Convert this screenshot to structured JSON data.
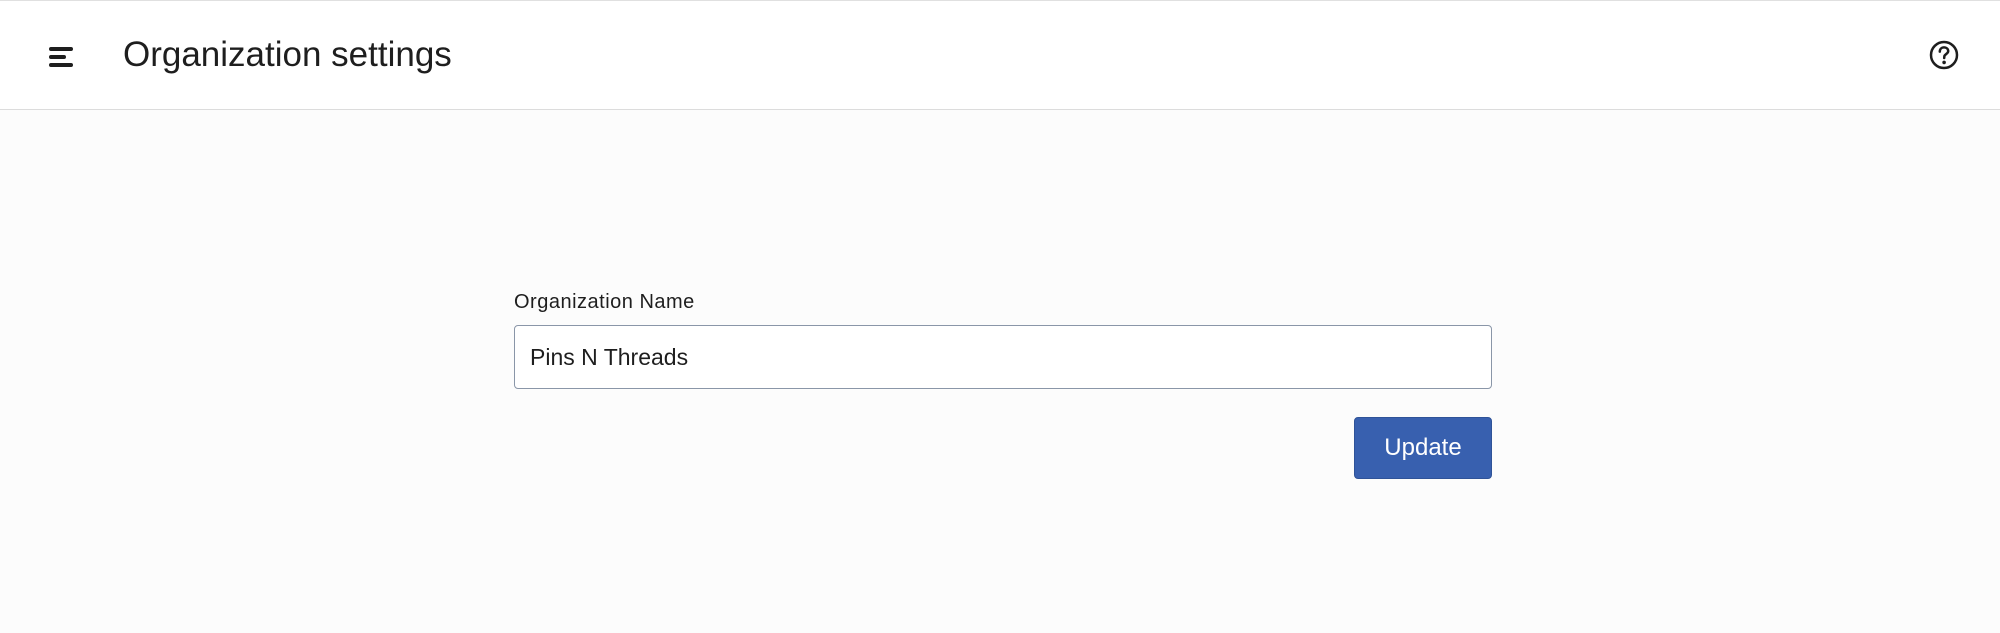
{
  "header": {
    "title": "Organization settings",
    "menu_icon": "hamburger-menu-icon",
    "help_icon": "help-circle-icon"
  },
  "form": {
    "organization_name_label": "Organization Name",
    "organization_name_value": "Pins N Threads",
    "update_label": "Update"
  },
  "colors": {
    "primary_button": "#3860af",
    "header_border": "#dcdcdc",
    "input_border": "#8a96a8"
  }
}
